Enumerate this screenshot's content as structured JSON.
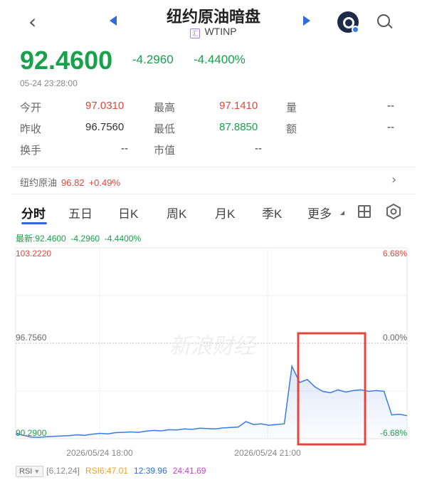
{
  "header": {
    "title": "纽约原油暗盘",
    "code": "WTINP",
    "code_badge": "汇",
    "back_icon": "chevron-left-icon",
    "prev_icon": "triangle-left-icon",
    "next_icon": "triangle-right-icon",
    "avatar_icon": "app-avatar-icon",
    "search_icon": "search-icon"
  },
  "quote": {
    "price": "92.4600",
    "change": "-4.2960",
    "change_pct": "-4.4400%",
    "timestamp": "05-24 23:28:00"
  },
  "stats": {
    "open_label": "今开",
    "open": "97.0310",
    "high_label": "最高",
    "high": "97.1410",
    "volume_label": "量",
    "volume": "--",
    "prev_close_label": "昨收",
    "prev_close": "96.7560",
    "low_label": "最低",
    "low": "87.8850",
    "amount_label": "额",
    "amount": "--",
    "turnover_label": "换手",
    "turnover": "--",
    "mktcap_label": "市值",
    "mktcap": "--"
  },
  "reference": {
    "name": "纽约原油",
    "value": "96.82",
    "pct": "+0.49%"
  },
  "tabs": [
    "分时",
    "五日",
    "日K",
    "周K",
    "月K",
    "季K",
    "更多"
  ],
  "chart_header": {
    "latest_label": "最新:",
    "latest": "92.4600",
    "change": "-4.2960",
    "change_pct": "-4.4400%"
  },
  "chart_data": {
    "type": "line",
    "ylim": [
      90.29,
      103.222
    ],
    "y_labels_left": [
      "103.2220",
      "96.7560",
      "90.2900"
    ],
    "y_labels_right": [
      "6.68%",
      "0.00%",
      "-6.68%"
    ],
    "x_labels": [
      "2026/05/24 18:00",
      "2026/05/24 21:00"
    ],
    "reference": 96.756,
    "watermark": "新浪财经",
    "series": [
      {
        "values": [
          90.62,
          90.52,
          90.4,
          90.38,
          90.42,
          90.45,
          90.48,
          90.5,
          90.55,
          90.52,
          90.6,
          90.65,
          90.62,
          90.7,
          90.72,
          90.75,
          90.72,
          90.8,
          90.85,
          90.82,
          90.9,
          90.88,
          90.95,
          90.92,
          91.0,
          90.98,
          90.95,
          91.02,
          91.05,
          91.08,
          91.45,
          91.25,
          91.3,
          91.2,
          91.25,
          91.3,
          95.2,
          94.1,
          94.3,
          93.8,
          93.5,
          93.4,
          93.6,
          93.45,
          93.55,
          93.6,
          93.5,
          93.55,
          93.5,
          91.9,
          91.95,
          91.85
        ]
      }
    ]
  },
  "rsi": {
    "selector": "RSI",
    "params": "[6,12,24]",
    "rsi6": "RSI6:47.01",
    "rsi12": "12:39.96",
    "rsi24": "24:41.69",
    "colors": {
      "rsi6": "#f0a020",
      "rsi12": "#2d6bd8",
      "rsi24": "#d03ad8"
    }
  },
  "colors": {
    "up": "#e8443a",
    "down": "#17a14a",
    "accent": "#2d6bd8",
    "highlight_box": "#e8443a"
  }
}
